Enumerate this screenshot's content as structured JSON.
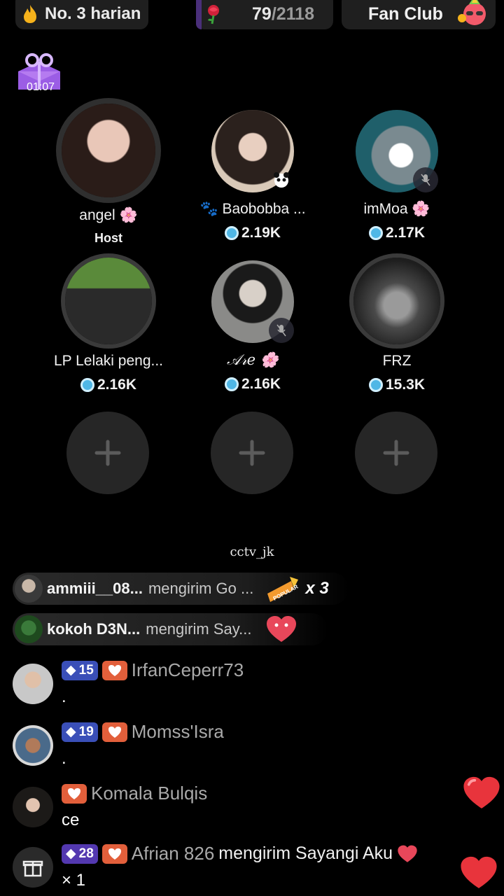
{
  "top_bar": {
    "rank_label": "No. 3 harian",
    "rose_current": "79",
    "rose_total": "/2118",
    "fan_club_label": "Fan Club"
  },
  "gift_timer": {
    "time": "01:07"
  },
  "seats": [
    {
      "name": "angel",
      "sub": "Host"
    },
    {
      "name": "Baobobba ...",
      "sub": "2.19K"
    },
    {
      "name": "imMoa",
      "sub": "2.17K"
    },
    {
      "name": "LP Lelaki peng...",
      "sub": "2.16K"
    },
    {
      "name": "𝒜𝓇𝑒",
      "sub": "2.16K"
    },
    {
      "name": "FRZ",
      "sub": "15.3K"
    }
  ],
  "watermark": "cctv_jk",
  "gift_banners": [
    {
      "user": "ammiii__08...",
      "message": "mengirim Go ...",
      "multiplier": "x 3"
    },
    {
      "user": "kokoh D3N...",
      "message": "mengirim Say..."
    }
  ],
  "chat": [
    {
      "level": "15",
      "user": "IrfanCeperr73",
      "text": "."
    },
    {
      "level": "19",
      "user": "Momss'Isra",
      "text": "."
    },
    {
      "user": "Komala Bulqis",
      "text": "ce"
    },
    {
      "level": "28",
      "user": "Afrian 826",
      "action": "mengirim Sayangi Aku",
      "count": "× 1"
    }
  ],
  "colors": {
    "background": "#000000",
    "pill": "#1f1f1f",
    "coin": "#4fb7e6",
    "level_badge": "#3a4fb8",
    "heart_badge": "#e25f3b",
    "heart": "#e8343c"
  }
}
